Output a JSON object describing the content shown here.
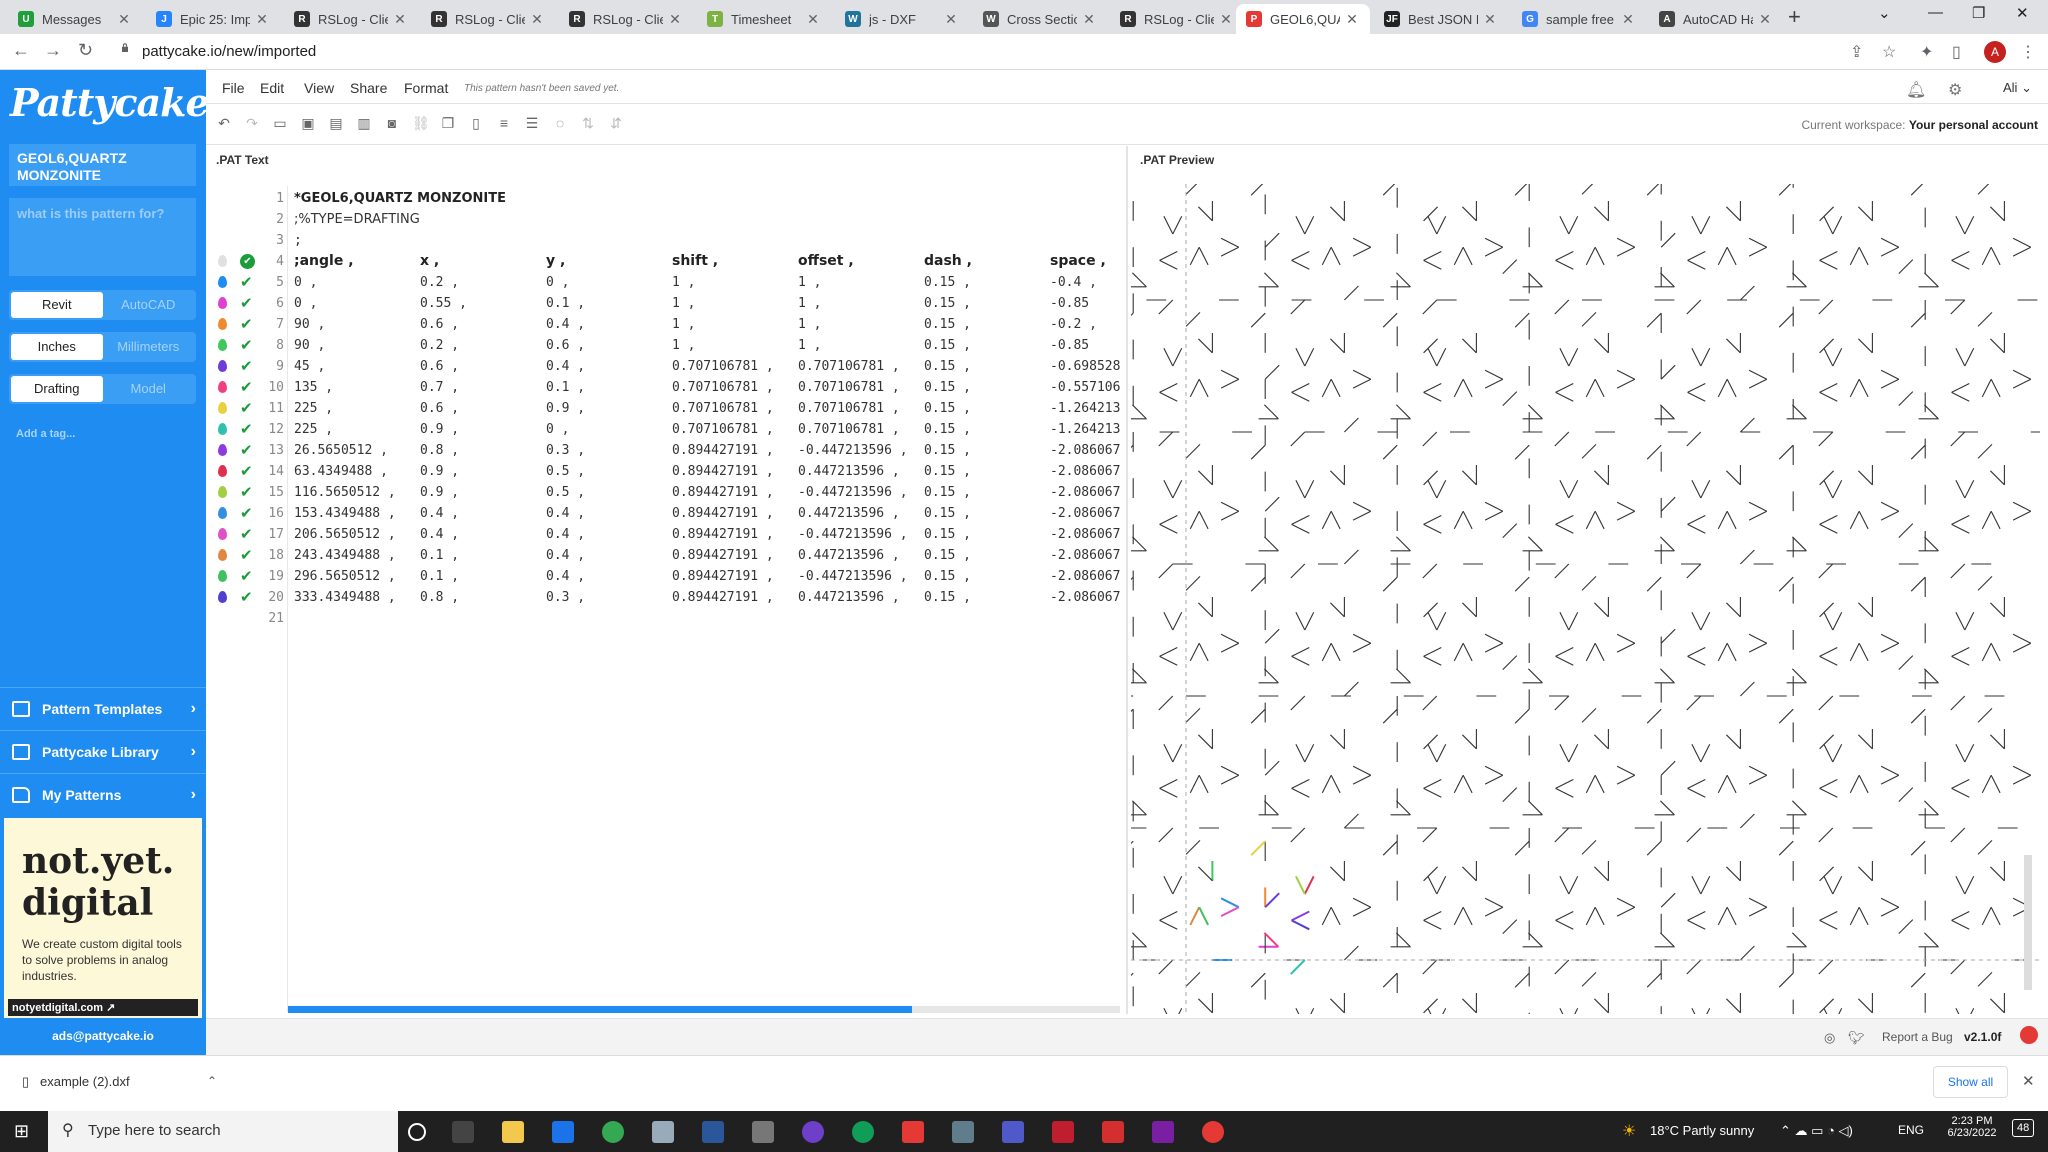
{
  "browser": {
    "tabs": [
      {
        "label": "Messages",
        "color": "#1f9e3a",
        "glyph": "U"
      },
      {
        "label": "Epic 25: Impo",
        "color": "#2684ff",
        "glyph": "J"
      },
      {
        "label": "RSLog - Clien",
        "color": "#333333",
        "glyph": "R"
      },
      {
        "label": "RSLog - Clien",
        "color": "#333333",
        "glyph": "R"
      },
      {
        "label": "RSLog - Clien",
        "color": "#333333",
        "glyph": "R"
      },
      {
        "label": "Timesheet",
        "color": "#7cb342",
        "glyph": "T"
      },
      {
        "label": "js - DXF",
        "color": "#21759b",
        "glyph": "W"
      },
      {
        "label": "Cross Section",
        "color": "#555555",
        "glyph": "W"
      },
      {
        "label": "RSLog - Clien",
        "color": "#333333",
        "glyph": "R"
      },
      {
        "label": "GEOL6,QUAR",
        "color": "#e53935",
        "glyph": "P"
      },
      {
        "label": "Best JSON Pr",
        "color": "#222222",
        "glyph": "JF"
      },
      {
        "label": "sample free a",
        "color": "#4285f4",
        "glyph": "G"
      },
      {
        "label": "AutoCAD Hat",
        "color": "#444444",
        "glyph": "A"
      }
    ],
    "active_tab": 9,
    "url": "pattycake.io/new/imported",
    "profile_initial": "A"
  },
  "sidebar": {
    "logo": "Pattycake",
    "pattern_name": "GEOL6,QUARTZ MONZONITE",
    "description_placeholder": "what is this pattern for?",
    "toggles": [
      {
        "left": "Revit",
        "right": "AutoCAD",
        "selected": "left"
      },
      {
        "left": "Inches",
        "right": "Millimeters",
        "selected": "left"
      },
      {
        "left": "Drafting",
        "right": "Model",
        "selected": "left"
      }
    ],
    "add_tag": "Add a tag...",
    "nav": [
      "Pattern Templates",
      "Pattycake Library",
      "My Patterns"
    ],
    "ad": {
      "headline_1": "not.yet.",
      "headline_2": "digital",
      "text": "We create custom digital tools to solve problems in analog industries.",
      "link": "notyetdigital.com"
    },
    "ads_email": "ads@pattycake.io"
  },
  "menu": {
    "items": [
      "File",
      "Edit",
      "View",
      "Share",
      "Format"
    ],
    "unsaved_note": "This pattern hasn't been saved yet.",
    "user": "Ali"
  },
  "toolbar": {
    "workspace_label": "Current workspace:",
    "workspace_value": "Your personal account"
  },
  "panels": {
    "pat_text_title": ".PAT Text",
    "pat_preview_title": ".PAT Preview"
  },
  "editor": {
    "title_line": "*GEOL6,QUARTZ MONZONITE",
    "type_line": ";%TYPE=DRAFTING",
    "comment_line": ";",
    "columns": [
      ";angle ,",
      "x ,",
      "y ,",
      "shift ,",
      "offset ,",
      "dash ,",
      "space ,"
    ],
    "rows": [
      {
        "color": "#1e8cf0",
        "v": [
          "0 ,",
          "0.2 ,",
          "0 ,",
          "1 ,",
          "1 ,",
          "0.15 ,",
          "-0.4 ,"
        ]
      },
      {
        "color": "#e040d0",
        "v": [
          "0 ,",
          "0.55 ,",
          "0.1 ,",
          "1 ,",
          "1 ,",
          "0.15 ,",
          "-0.85"
        ]
      },
      {
        "color": "#f08a30",
        "v": [
          "90 ,",
          "0.6 ,",
          "0.4 ,",
          "1 ,",
          "1 ,",
          "0.15 ,",
          "-0.2 ,"
        ]
      },
      {
        "color": "#3cc85a",
        "v": [
          "90 ,",
          "0.2 ,",
          "0.6 ,",
          "1 ,",
          "1 ,",
          "0.15 ,",
          "-0.85"
        ]
      },
      {
        "color": "#6a3cd8",
        "v": [
          "45 ,",
          "0.6 ,",
          "0.4 ,",
          "0.707106781 ,",
          "0.707106781 ,",
          "0.15 ,",
          "-0.698528"
        ]
      },
      {
        "color": "#f04080",
        "v": [
          "135 ,",
          "0.7 ,",
          "0.1 ,",
          "0.707106781 ,",
          "0.707106781 ,",
          "0.15 ,",
          "-0.557106"
        ]
      },
      {
        "color": "#e8d040",
        "v": [
          "225 ,",
          "0.6 ,",
          "0.9 ,",
          "0.707106781 ,",
          "0.707106781 ,",
          "0.15 ,",
          "-1.264213"
        ]
      },
      {
        "color": "#30c0b0",
        "v": [
          "225 ,",
          "0.9 ,",
          "0 ,",
          "0.707106781 ,",
          "0.707106781 ,",
          "0.15 ,",
          "-1.264213"
        ]
      },
      {
        "color": "#8a3ce0",
        "v": [
          "26.5650512 ,",
          "0.8 ,",
          "0.3 ,",
          "0.894427191 ,",
          "-0.447213596 ,",
          "0.15 ,",
          "-2.086067"
        ]
      },
      {
        "color": "#e03050",
        "v": [
          "63.4349488 ,",
          "0.9 ,",
          "0.5 ,",
          "0.894427191 ,",
          "0.447213596 ,",
          "0.15 ,",
          "-2.086067"
        ]
      },
      {
        "color": "#a0d040",
        "v": [
          "116.5650512 ,",
          "0.9 ,",
          "0.5 ,",
          "0.894427191 ,",
          "-0.447213596 ,",
          "0.15 ,",
          "-2.086067"
        ]
      },
      {
        "color": "#3090e0",
        "v": [
          "153.4349488 ,",
          "0.4 ,",
          "0.4 ,",
          "0.894427191 ,",
          "0.447213596 ,",
          "0.15 ,",
          "-2.086067"
        ]
      },
      {
        "color": "#e050c8",
        "v": [
          "206.5650512 ,",
          "0.4 ,",
          "0.4 ,",
          "0.894427191 ,",
          "-0.447213596 ,",
          "0.15 ,",
          "-2.086067"
        ]
      },
      {
        "color": "#e08840",
        "v": [
          "243.4349488 ,",
          "0.1 ,",
          "0.4 ,",
          "0.894427191 ,",
          "0.447213596 ,",
          "0.15 ,",
          "-2.086067"
        ]
      },
      {
        "color": "#40c060",
        "v": [
          "296.5650512 ,",
          "0.1 ,",
          "0.4 ,",
          "0.894427191 ,",
          "-0.447213596 ,",
          "0.15 ,",
          "-2.086067"
        ]
      },
      {
        "color": "#5040d0",
        "v": [
          "333.4349488 ,",
          "0.8 ,",
          "0.3 ,",
          "0.894427191 ,",
          "0.447213596 ,",
          "0.15 ,",
          "-2.086067"
        ]
      }
    ],
    "last_line_number": "21"
  },
  "footer": {
    "report_bug": "Report a Bug",
    "version": "v2.1.0f"
  },
  "downloads": {
    "file": "example (2).dxf",
    "show_all": "Show all"
  },
  "taskbar": {
    "search_placeholder": "Type here to search",
    "weather": "18°C  Partly sunny",
    "lang": "ENG",
    "time": "2:23 PM",
    "date": "6/23/2022",
    "notifications": "48"
  }
}
